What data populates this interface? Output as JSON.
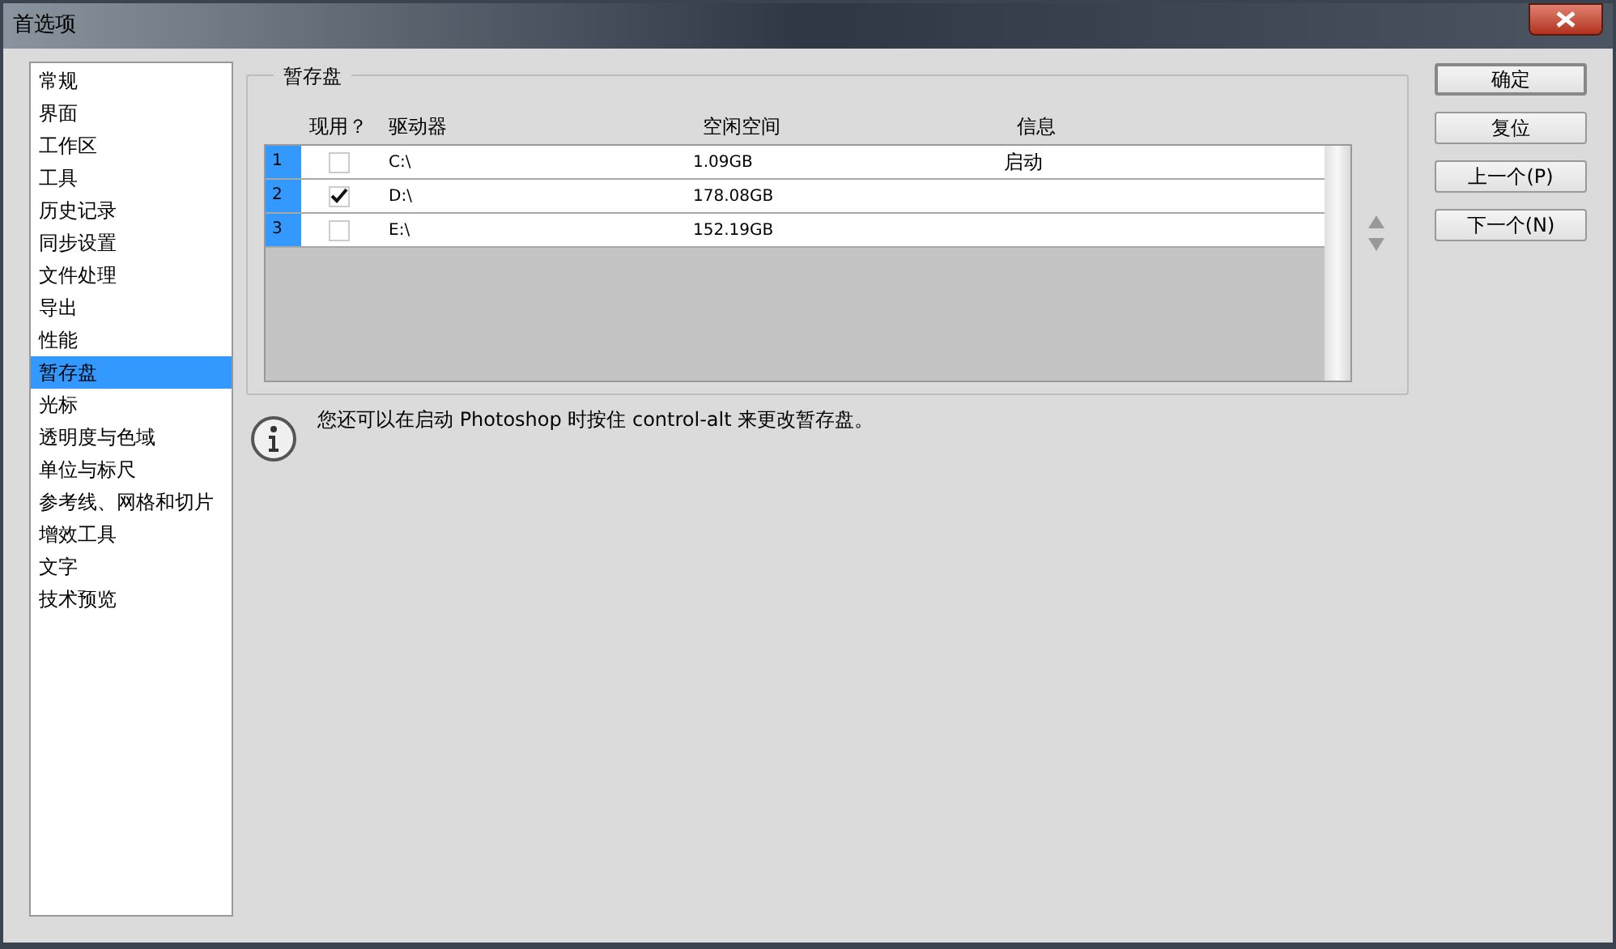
{
  "window": {
    "title": "首选项"
  },
  "sidebar": {
    "items": [
      {
        "label": "常规",
        "selected": false
      },
      {
        "label": "界面",
        "selected": false
      },
      {
        "label": "工作区",
        "selected": false
      },
      {
        "label": "工具",
        "selected": false
      },
      {
        "label": "历史记录",
        "selected": false
      },
      {
        "label": "同步设置",
        "selected": false
      },
      {
        "label": "文件处理",
        "selected": false
      },
      {
        "label": "导出",
        "selected": false
      },
      {
        "label": "性能",
        "selected": false
      },
      {
        "label": "暂存盘",
        "selected": true
      },
      {
        "label": "光标",
        "selected": false
      },
      {
        "label": "透明度与色域",
        "selected": false
      },
      {
        "label": "单位与标尺",
        "selected": false
      },
      {
        "label": "参考线、网格和切片",
        "selected": false
      },
      {
        "label": "增效工具",
        "selected": false
      },
      {
        "label": "文字",
        "selected": false
      },
      {
        "label": "技术预览",
        "selected": false
      }
    ]
  },
  "scratch_disks": {
    "title": "暂存盘",
    "columns": [
      "现用？",
      "驱动器",
      "空闲空间",
      "信息"
    ],
    "rows": [
      {
        "index": "1",
        "active": false,
        "drive": "C:\\",
        "free": "1.09GB",
        "info": "启动"
      },
      {
        "index": "2",
        "active": true,
        "drive": "D:\\",
        "free": "178.08GB"
      },
      {
        "index": "3",
        "active": false,
        "drive": "E:\\",
        "free": "152.19GB"
      }
    ]
  },
  "note": "您还可以在启动 Photoshop 时按住 control-alt 来更改暂存盘。",
  "buttons": [
    {
      "label": "确定",
      "default": true
    },
    {
      "label": "复位",
      "default": false
    },
    {
      "label": "上一个(P)",
      "default": false
    },
    {
      "label": "下一个(N)",
      "default": false
    }
  ]
}
